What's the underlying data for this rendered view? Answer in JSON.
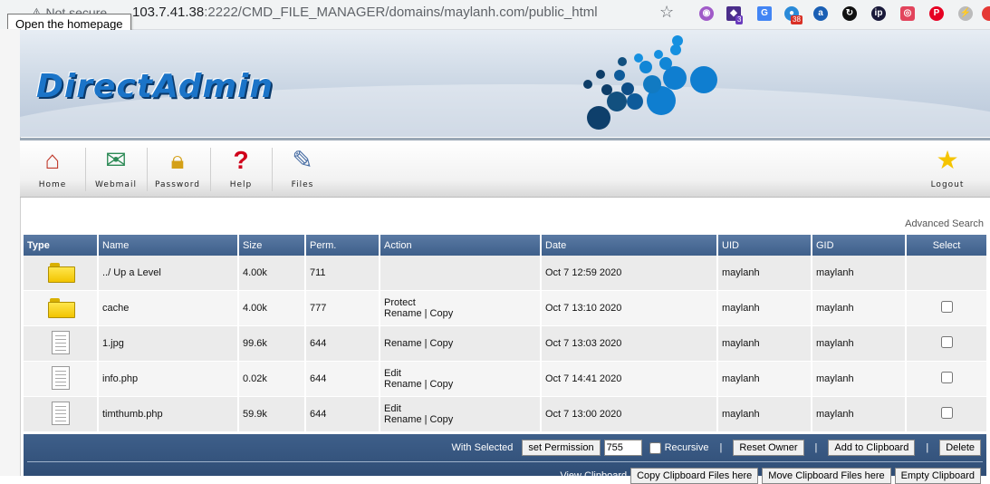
{
  "browser": {
    "security_label": "Not secure",
    "url_host": "103.7.41.38",
    "url_rest": ":2222/CMD_FILE_MANAGER/domains/maylanh.com/public_html",
    "ext_badge_1": "3",
    "ext_badge_2": "38",
    "tooltip": "Open the homepage"
  },
  "header": {
    "logo_text": "DirectAdmin"
  },
  "nav": {
    "items": [
      {
        "label": "Home",
        "icon": "home-icon"
      },
      {
        "label": "Webmail",
        "icon": "envelope-icon"
      },
      {
        "label": "Password",
        "icon": "lock-icon"
      },
      {
        "label": "Help",
        "icon": "question-icon"
      },
      {
        "label": "Files",
        "icon": "files-icon"
      }
    ],
    "logout": {
      "label": "Logout",
      "icon": "star-icon"
    }
  },
  "advanced_search": "Advanced Search",
  "table": {
    "headers": [
      "Type",
      "Name",
      "Size",
      "Perm.",
      "Action",
      "Date",
      "UID",
      "GID",
      "Select"
    ],
    "rows": [
      {
        "type": "folder",
        "name": "../ Up a Level",
        "size": "4.00k",
        "perm": "711",
        "action1": "",
        "action2": "",
        "date": "Oct 7 12:59 2020",
        "uid": "maylanh",
        "gid": "maylanh",
        "select": false
      },
      {
        "type": "folder",
        "name": "cache",
        "size": "4.00k",
        "perm": "777",
        "action1": "Protect",
        "action2": "Rename | Copy",
        "date": "Oct 7 13:10 2020",
        "uid": "maylanh",
        "gid": "maylanh",
        "select": true
      },
      {
        "type": "file",
        "name": "1.jpg",
        "size": "99.6k",
        "perm": "644",
        "action1": "",
        "action2": "Rename | Copy",
        "date": "Oct 7 13:03 2020",
        "uid": "maylanh",
        "gid": "maylanh",
        "select": true
      },
      {
        "type": "file",
        "name": "info.php",
        "size": "0.02k",
        "perm": "644",
        "action1": "Edit",
        "action2": "Rename | Copy",
        "date": "Oct 7 14:41 2020",
        "uid": "maylanh",
        "gid": "maylanh",
        "select": true
      },
      {
        "type": "file",
        "name": "timthumb.php",
        "size": "59.9k",
        "perm": "644",
        "action1": "Edit",
        "action2": "Rename | Copy",
        "date": "Oct 7 13:00 2020",
        "uid": "maylanh",
        "gid": "maylanh",
        "select": true
      }
    ]
  },
  "bottom": {
    "with_selected": "With Selected",
    "set_permission": "set Permission",
    "permission_value": "755",
    "recursive": "Recursive",
    "reset_owner": "Reset Owner",
    "add_clipboard": "Add to Clipboard",
    "delete": "Delete",
    "view_clipboard": "View Clipboard",
    "copy_clipboard": "Copy Clipboard Files here",
    "move_clipboard": "Move Clipboard Files here",
    "empty_clipboard": "Empty Clipboard"
  }
}
